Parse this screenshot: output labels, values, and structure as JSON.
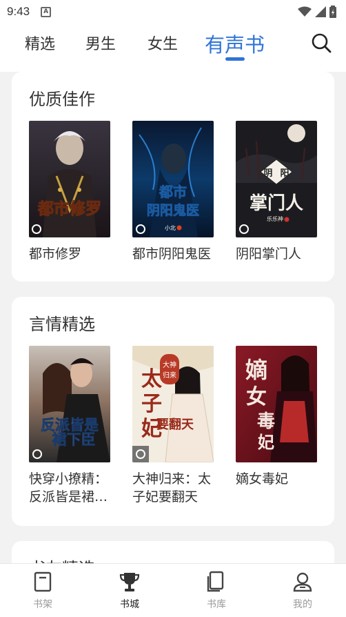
{
  "status_bar": {
    "time": "9:43",
    "notification_glyph": "A"
  },
  "top_nav": {
    "tabs": [
      {
        "label": "精选",
        "active": false
      },
      {
        "label": "男生",
        "active": false
      },
      {
        "label": "女生",
        "active": false
      },
      {
        "label": "有声书",
        "active": true
      }
    ],
    "accent_color": "#2f74d6",
    "search_icon": "search-icon"
  },
  "sections": [
    {
      "title": "优质佳作",
      "books": [
        {
          "title": "都市修罗",
          "cover_text": "都市修罗"
        },
        {
          "title": "都市阴阳鬼医",
          "cover_text": "都市阴阳鬼医",
          "cover_author": "小北"
        },
        {
          "title": "阴阳掌门人",
          "cover_text": "阴阳掌门人",
          "cover_author": "乐乐神"
        }
      ]
    },
    {
      "title": "言情精选",
      "books": [
        {
          "title_line1": "快穿小撩精：",
          "title_line2": "反派皆是裙下臣",
          "cover_text": "反派皆是裙下臣"
        },
        {
          "title_line1": "大神归来：太",
          "title_line2": "子妃要翻天",
          "cover_text": "太子妃要翻天"
        },
        {
          "title": "嫡女毒妃",
          "cover_text": "嫡女毒妃"
        }
      ]
    },
    {
      "title": "书友精选"
    }
  ],
  "bottom_nav": [
    {
      "label": "书架",
      "icon": "bookshelf-icon",
      "active": false
    },
    {
      "label": "书城",
      "icon": "trophy-icon",
      "active": true
    },
    {
      "label": "书库",
      "icon": "library-icon",
      "active": false
    },
    {
      "label": "我的",
      "icon": "profile-icon",
      "active": false
    }
  ]
}
